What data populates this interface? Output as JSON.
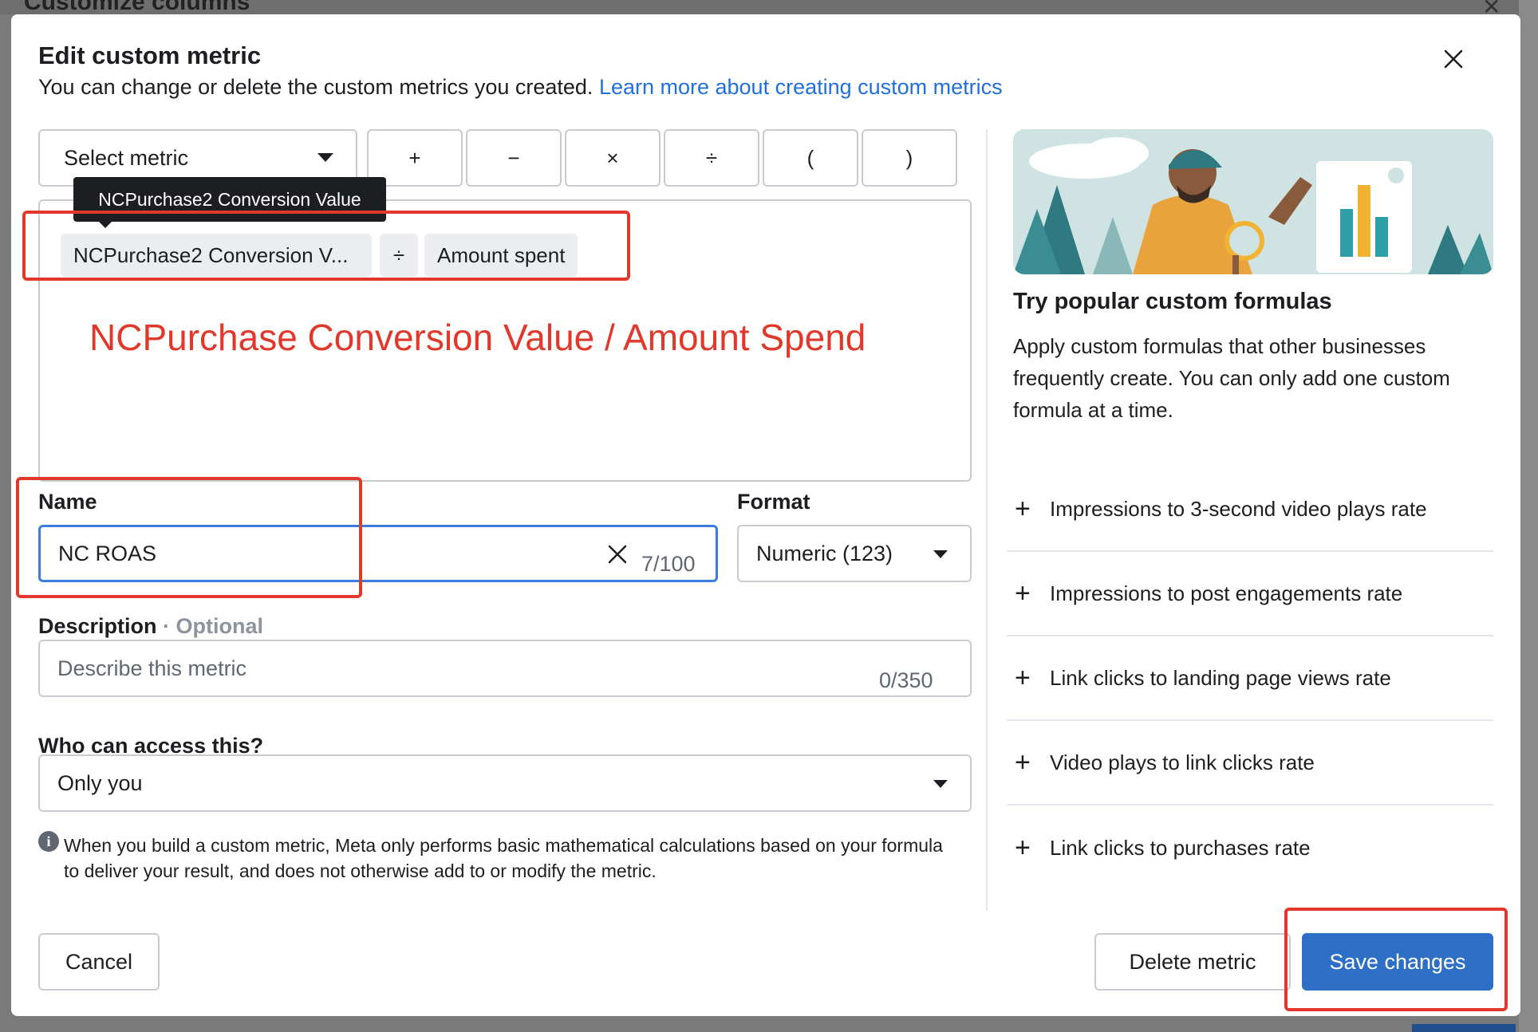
{
  "background": {
    "title": "Customize columns"
  },
  "modal": {
    "title": "Edit custom metric",
    "subtitle": "You can change or delete the custom metrics you created.",
    "learn_more": "Learn more about creating custom metrics"
  },
  "formula_bar": {
    "select_metric": "Select metric",
    "operators": [
      "+",
      "−",
      "×",
      "÷",
      "(",
      ")"
    ]
  },
  "formula": {
    "tooltip": "NCPurchase2 Conversion Value",
    "chips": [
      "NCPurchase2 Conversion V...",
      "÷",
      "Amount spent"
    ],
    "annotation": "NCPurchase Conversion Value / Amount Spend"
  },
  "name_field": {
    "label": "Name",
    "value": "NC ROAS",
    "count": "7/100"
  },
  "format_field": {
    "label": "Format",
    "value": "Numeric (123)"
  },
  "description_field": {
    "label": "Description",
    "optional": "· Optional",
    "placeholder": "Describe this metric",
    "count": "0/350"
  },
  "access_field": {
    "label": "Who can access this?",
    "value": "Only you"
  },
  "info": {
    "text": "When you build a custom metric, Meta only performs basic mathematical calculations based on your formula to deliver your result, and does not otherwise add to or modify the metric."
  },
  "panel": {
    "title": "Try popular custom formulas",
    "description": "Apply custom formulas that other businesses frequently create. You can only add one custom formula at a time.",
    "formulas": [
      "Impressions to 3-second video plays rate",
      "Impressions to post engagements rate",
      "Link clicks to landing page views rate",
      "Video plays to link clicks rate",
      "Link clicks to purchases rate"
    ]
  },
  "footer": {
    "cancel": "Cancel",
    "delete": "Delete metric",
    "save": "Save changes"
  },
  "colors": {
    "primary": "#2d6fc6",
    "link": "#216fdb",
    "annotation_red": "#e0392b",
    "focus_border": "#3b7ce0"
  }
}
